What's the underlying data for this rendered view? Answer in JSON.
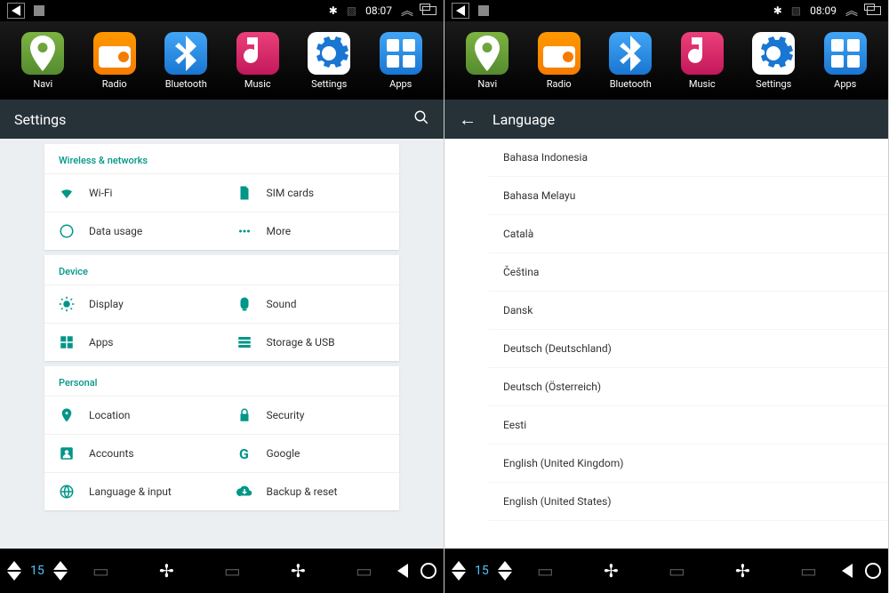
{
  "status": {
    "time_left": "08:07",
    "time_right": "08:09"
  },
  "dock": [
    {
      "label": "Navi"
    },
    {
      "label": "Radio"
    },
    {
      "label": "Bluetooth"
    },
    {
      "label": "Music"
    },
    {
      "label": "Settings"
    },
    {
      "label": "Apps"
    }
  ],
  "left": {
    "header": "Settings",
    "sections": [
      {
        "title": "Wireless & networks",
        "items": [
          {
            "label": "Wi-Fi",
            "icon": "wifi"
          },
          {
            "label": "SIM cards",
            "icon": "sim"
          },
          {
            "label": "Data usage",
            "icon": "data"
          },
          {
            "label": "More",
            "icon": "more"
          }
        ]
      },
      {
        "title": "Device",
        "items": [
          {
            "label": "Display",
            "icon": "display"
          },
          {
            "label": "Sound",
            "icon": "sound"
          },
          {
            "label": "Apps",
            "icon": "apps"
          },
          {
            "label": "Storage & USB",
            "icon": "storage"
          }
        ]
      },
      {
        "title": "Personal",
        "items": [
          {
            "label": "Location",
            "icon": "location"
          },
          {
            "label": "Security",
            "icon": "security"
          },
          {
            "label": "Accounts",
            "icon": "accounts"
          },
          {
            "label": "Google",
            "icon": "google"
          },
          {
            "label": "Language & input",
            "icon": "language"
          },
          {
            "label": "Backup & reset",
            "icon": "backup"
          }
        ]
      }
    ]
  },
  "right": {
    "header": "Language",
    "languages": [
      "Bahasa Indonesia",
      "Bahasa Melayu",
      "Català",
      "Čeština",
      "Dansk",
      "Deutsch (Deutschland)",
      "Deutsch (Österreich)",
      "Eesti",
      "English (United Kingdom)",
      "English (United States)"
    ]
  },
  "bottom": {
    "temp": "15"
  }
}
